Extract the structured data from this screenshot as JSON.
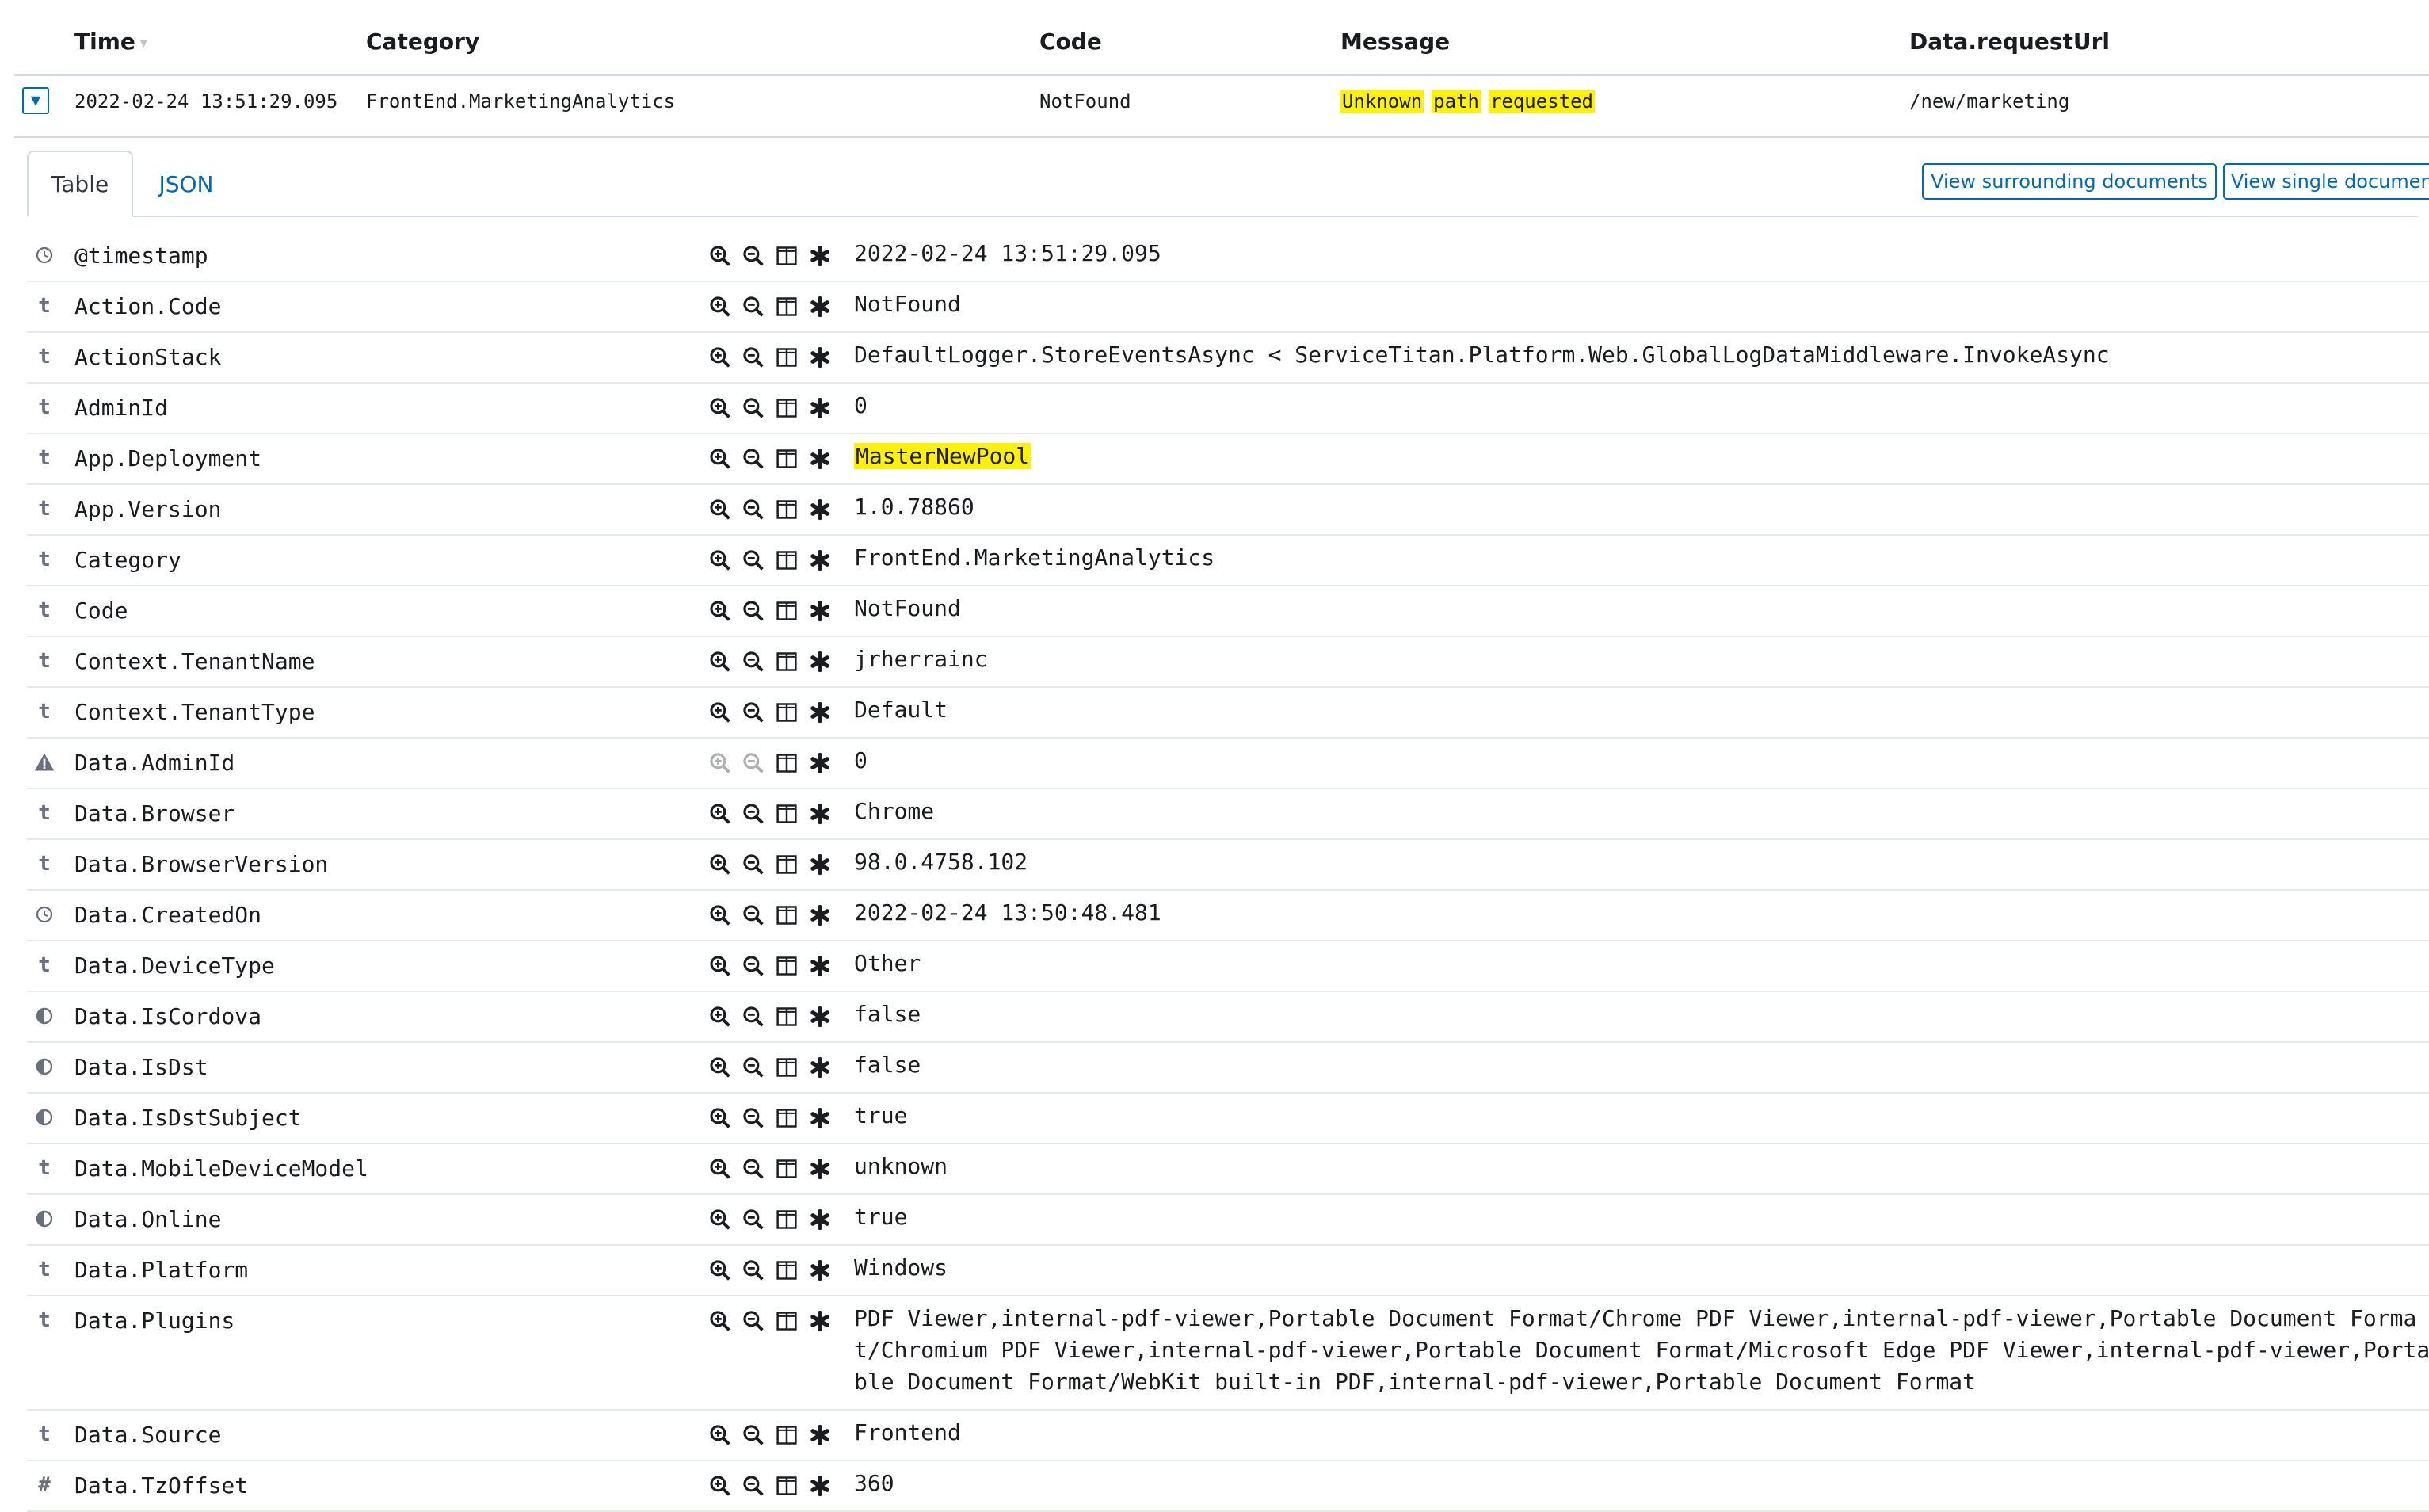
{
  "columns": {
    "time": "Time",
    "category": "Category",
    "code": "Code",
    "message": "Message",
    "request_url": "Data.requestUrl"
  },
  "doc_row": {
    "time": "2022-02-24 13:51:29.095",
    "category": "FrontEnd.MarketingAnalytics",
    "code": "NotFound",
    "message_words": [
      "Unknown",
      "path",
      "requested"
    ],
    "request_url": "/new/marketing"
  },
  "tabs": {
    "table": "Table",
    "json": "JSON"
  },
  "buttons": {
    "surrounding": "View surrounding documents",
    "single": "View single document"
  },
  "icons": {
    "filter_for": "magnify-plus-icon",
    "filter_out": "magnify-minus-icon",
    "toggle_column": "columns-icon",
    "exists": "asterisk-icon",
    "date": "clock-icon",
    "string": "t",
    "boolean": "half-circle-icon",
    "warning": "warning-icon",
    "number": "#"
  },
  "colors": {
    "link": "#006bb4",
    "highlight": "#fff200",
    "border": "#d3dae6"
  },
  "fields": [
    {
      "type": "date",
      "name": "@timestamp",
      "value": "2022-02-24 13:51:29.095"
    },
    {
      "type": "string",
      "name": "Action.Code",
      "value": "NotFound"
    },
    {
      "type": "string",
      "name": "ActionStack",
      "value": "DefaultLogger.StoreEventsAsync < ServiceTitan.Platform.Web.GlobalLogDataMiddleware.InvokeAsync"
    },
    {
      "type": "string",
      "name": "AdminId",
      "value": "0"
    },
    {
      "type": "string",
      "name": "App.Deployment",
      "value": "MasterNewPool",
      "highlight": true
    },
    {
      "type": "string",
      "name": "App.Version",
      "value": "1.0.78860"
    },
    {
      "type": "string",
      "name": "Category",
      "value": "FrontEnd.MarketingAnalytics"
    },
    {
      "type": "string",
      "name": "Code",
      "value": "NotFound"
    },
    {
      "type": "string",
      "name": "Context.TenantName",
      "value": "jrherrainc"
    },
    {
      "type": "string",
      "name": "Context.TenantType",
      "value": "Default"
    },
    {
      "type": "warning",
      "name": "Data.AdminId",
      "value": "0",
      "filters_disabled": true
    },
    {
      "type": "string",
      "name": "Data.Browser",
      "value": "Chrome"
    },
    {
      "type": "string",
      "name": "Data.BrowserVersion",
      "value": "98.0.4758.102"
    },
    {
      "type": "date",
      "name": "Data.CreatedOn",
      "value": "2022-02-24 13:50:48.481"
    },
    {
      "type": "string",
      "name": "Data.DeviceType",
      "value": "Other"
    },
    {
      "type": "boolean",
      "name": "Data.IsCordova",
      "value": "false"
    },
    {
      "type": "boolean",
      "name": "Data.IsDst",
      "value": "false"
    },
    {
      "type": "boolean",
      "name": "Data.IsDstSubject",
      "value": "true"
    },
    {
      "type": "string",
      "name": "Data.MobileDeviceModel",
      "value": "unknown"
    },
    {
      "type": "boolean",
      "name": "Data.Online",
      "value": "true"
    },
    {
      "type": "string",
      "name": "Data.Platform",
      "value": "Windows"
    },
    {
      "type": "string",
      "name": "Data.Plugins",
      "value": "PDF Viewer,internal-pdf-viewer,Portable Document Format/Chrome PDF Viewer,internal-pdf-viewer,Portable Document Format/Chromium PDF Viewer,internal-pdf-viewer,Portable Document Format/Microsoft Edge PDF Viewer,internal-pdf-viewer,Portable Document Format/WebKit built-in PDF,internal-pdf-viewer,Portable Document Format",
      "tall": true
    },
    {
      "type": "string",
      "name": "Data.Source",
      "value": "Frontend"
    },
    {
      "type": "number",
      "name": "Data.TzOffset",
      "value": "360"
    }
  ]
}
